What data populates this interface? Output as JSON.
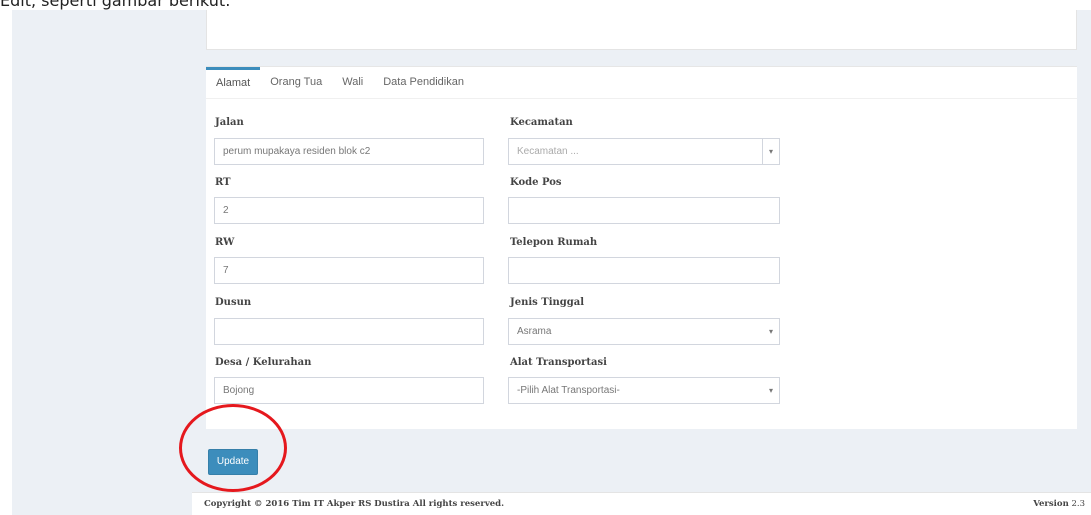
{
  "caption": "Edit, seperti gambar berikut:",
  "tabs": [
    "Alamat",
    "Orang Tua",
    "Wali",
    "Data Pendidikan"
  ],
  "form": {
    "jalan": {
      "label": "Jalan",
      "value": "perum mupakaya residen blok c2"
    },
    "rt": {
      "label": "RT",
      "value": "2"
    },
    "rw": {
      "label": "RW",
      "value": "7"
    },
    "dusun": {
      "label": "Dusun",
      "value": ""
    },
    "desa": {
      "label": "Desa / Kelurahan",
      "value": "Bojong"
    },
    "kecamatan": {
      "label": "Kecamatan",
      "placeholder": "Kecamatan ..."
    },
    "kode_pos": {
      "label": "Kode Pos",
      "value": ""
    },
    "telepon": {
      "label": "Telepon Rumah",
      "value": ""
    },
    "jenis_tinggal": {
      "label": "Jenis Tinggal",
      "value": "Asrama"
    },
    "alat_transportasi": {
      "label": "Alat Transportasi",
      "value": "-Pilih Alat Transportasi-"
    }
  },
  "buttons": {
    "update": "Update"
  },
  "footer": {
    "copyright": "Copyright © 2016 Tim IT Akper RS Dustira All rights reserved.",
    "version_label": "Version",
    "version_number": "2.3"
  },
  "colors": {
    "primary": "#3c8dbc",
    "highlight": "#e5181d",
    "background": "#ecf0f5"
  }
}
